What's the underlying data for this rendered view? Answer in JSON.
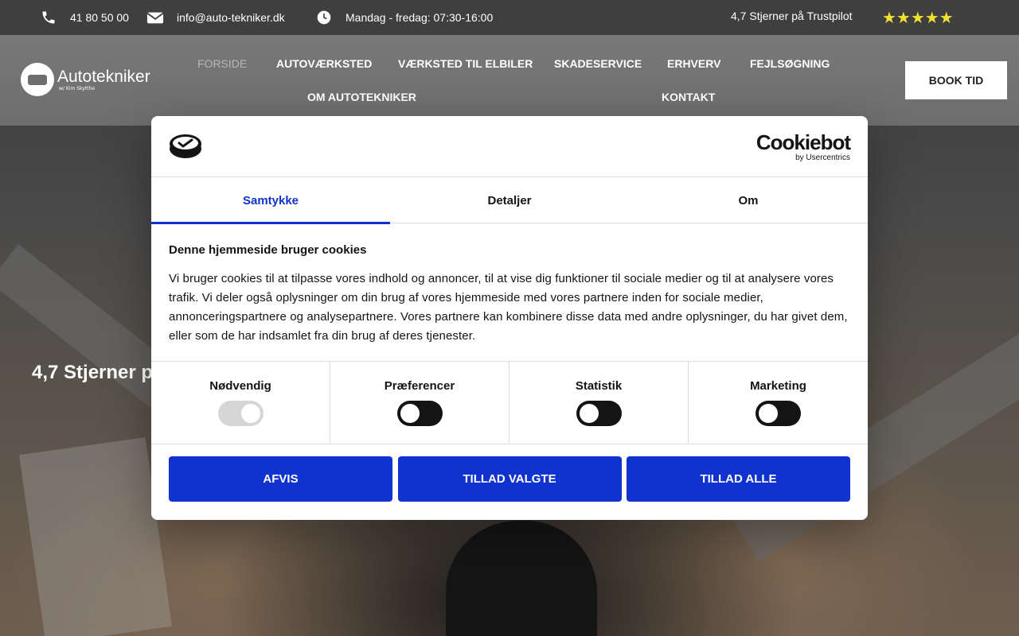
{
  "topbar": {
    "phone": "41 80 50 00",
    "email": "info@auto-tekniker.dk",
    "hours": "Mandag - fredag: 07:30-16:00",
    "rating_text": "4,7 Stjerner på Trustpilot",
    "stars": "★★★★★",
    "star_color": "#f0e030"
  },
  "logo": {
    "name": "Autotekniker",
    "sub": "w/ Kim Skytthe"
  },
  "nav": {
    "items": [
      {
        "label": "FORSIDE",
        "active": true
      },
      {
        "label": "AUTOVÆRKSTED"
      },
      {
        "label": "VÆRKSTED TIL ELBILER"
      },
      {
        "label": "SKADESERVICE"
      },
      {
        "label": "ERHVERV"
      },
      {
        "label": "FEJLSØGNING"
      },
      {
        "label": "OM AUTOTEKNIKER"
      },
      {
        "label": "KONTAKT"
      }
    ],
    "book_label": "BOOK TID"
  },
  "hero": {
    "heading": "4,7 Stjerner p"
  },
  "cookie": {
    "brand": "Cookiebot",
    "brand_sub": "by Usercentrics",
    "accent": "#1032cf",
    "tabs": [
      {
        "label": "Samtykke",
        "active": true
      },
      {
        "label": "Detaljer"
      },
      {
        "label": "Om"
      }
    ],
    "title": "Denne hjemmeside bruger cookies",
    "text": "Vi bruger cookies til at tilpasse vores indhold og annoncer, til at vise dig funktioner til sociale medier og til at analysere vores trafik. Vi deler også oplysninger om din brug af vores hjemmeside med vores partnere inden for sociale medier, annonceringspartnere og analysepartnere. Vores partnere kan kombinere disse data med andre oplysninger, du har givet dem, eller som de har indsamlet fra din brug af deres tjenester.",
    "toggles": [
      {
        "label": "Nødvendig",
        "on": true,
        "disabled": true
      },
      {
        "label": "Præferencer",
        "on": false
      },
      {
        "label": "Statistik",
        "on": false
      },
      {
        "label": "Marketing",
        "on": false
      }
    ],
    "buttons": {
      "deny": "AFVIS",
      "allow_selected": "TILLAD VALGTE",
      "allow_all": "TILLAD ALLE"
    }
  }
}
